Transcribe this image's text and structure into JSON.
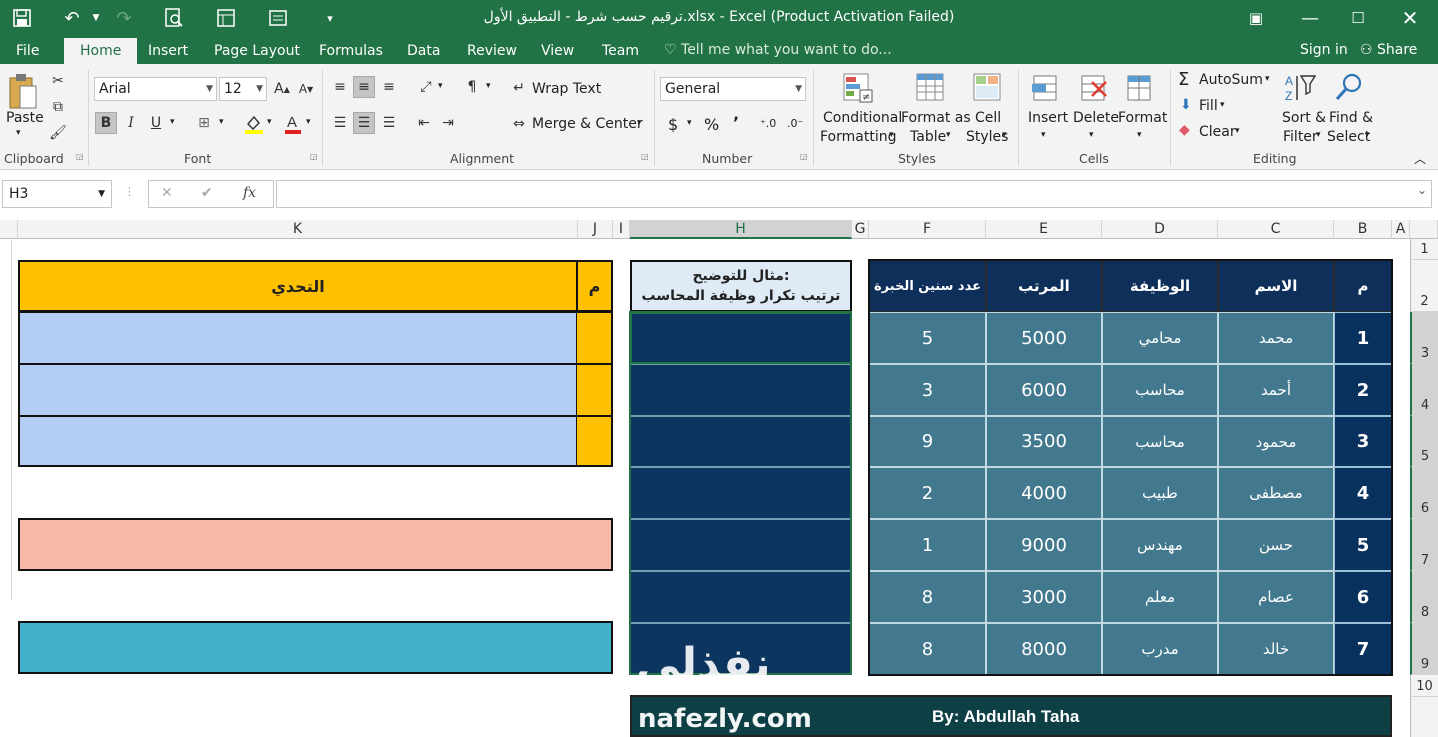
{
  "window": {
    "title": "ترقيم حسب شرط - التطبيق الأول.xlsx - Excel (Product Activation Failed)"
  },
  "tabs": [
    "File",
    "Home",
    "Insert",
    "Page Layout",
    "Formulas",
    "Data",
    "Review",
    "View",
    "Team"
  ],
  "tell_me": "Tell me what you want to do...",
  "signin": "Sign in",
  "share": "Share",
  "ribbon": {
    "clipboard": {
      "paste": "Paste",
      "label": "Clipboard"
    },
    "font": {
      "name": "Arial",
      "size": "12",
      "label": "Font",
      "bold": "B",
      "italic": "I",
      "underline": "U"
    },
    "alignment": {
      "wrap": "Wrap Text",
      "merge": "Merge & Center",
      "label": "Alignment"
    },
    "number": {
      "format": "General",
      "label": "Number",
      "currency": "$",
      "percent": "%",
      "comma": "’"
    },
    "styles": {
      "cond1": "Conditional",
      "cond2": "Formatting",
      "fmt1": "Format as",
      "fmt2": "Table",
      "cell1": "Cell",
      "cell2": "Styles",
      "label": "Styles"
    },
    "cells": {
      "insert": "Insert",
      "delete": "Delete",
      "format": "Format",
      "label": "Cells"
    },
    "editing": {
      "autosum": "AutoSum",
      "fill": "Fill",
      "clear": "Clear",
      "sort1": "Sort &",
      "sort2": "Filter",
      "find1": "Find &",
      "find2": "Select",
      "label": "Editing"
    }
  },
  "formula_bar": {
    "name_box": "H3",
    "fx": "fx",
    "value": ""
  },
  "columns": [
    "K",
    "J",
    "I",
    "H",
    "G",
    "F",
    "E",
    "D",
    "C",
    "B",
    "A"
  ],
  "rows": [
    "1",
    "2",
    "3",
    "4",
    "5",
    "6",
    "7",
    "8",
    "9",
    "10"
  ],
  "main_table": {
    "headers": {
      "num": "م",
      "name": "الاسم",
      "job": "الوظيفة",
      "salary": "المرتب",
      "years": "عدد سنين الخبرة"
    },
    "rows": [
      {
        "num": "1",
        "name": "محمد",
        "job": "محامي",
        "salary": "5000",
        "years": "5"
      },
      {
        "num": "2",
        "name": "أحمد",
        "job": "محاسب",
        "salary": "6000",
        "years": "3"
      },
      {
        "num": "3",
        "name": "محمود",
        "job": "محاسب",
        "salary": "3500",
        "years": "9"
      },
      {
        "num": "4",
        "name": "مصطفى",
        "job": "طبيب",
        "salary": "4000",
        "years": "2"
      },
      {
        "num": "5",
        "name": "حسن",
        "job": "مهندس",
        "salary": "9000",
        "years": "1"
      },
      {
        "num": "6",
        "name": "عصام",
        "job": "معلم",
        "salary": "3000",
        "years": "8"
      },
      {
        "num": "7",
        "name": "خالد",
        "job": "مدرب",
        "salary": "8000",
        "years": "8"
      }
    ]
  },
  "example_header": {
    "line1": "مثال للتوضيح:",
    "line2": "ترتيب تكرار وظيفة المحاسب"
  },
  "challenge": {
    "num_header": "م",
    "title": "التحدي"
  },
  "footer": {
    "author": "By: Abdullah Taha",
    "watermark_logo": "نفذلي",
    "watermark_url": "nafezly.com"
  },
  "colors": {
    "excel_green": "#217346",
    "orange": "#ffc000",
    "light_blue": "#b4cdf5",
    "salmon": "#f8bba8",
    "cyan": "#40b1c9",
    "navy": "#0c3660",
    "teal": "#43798e"
  }
}
